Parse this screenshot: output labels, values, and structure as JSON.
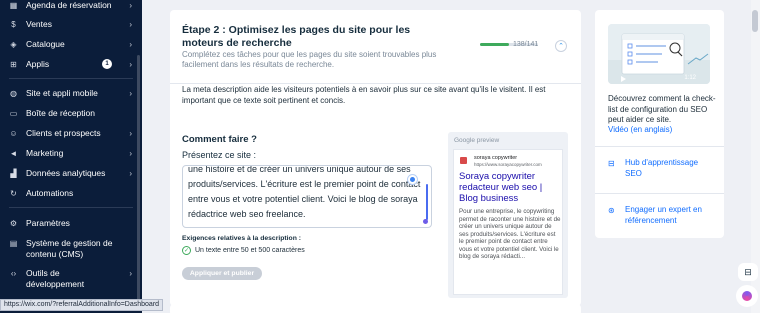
{
  "sidebar": {
    "items": [
      {
        "label": "Agenda de réservation",
        "icon": "calendar-icon",
        "chevron": "›"
      },
      {
        "label": "Ventes",
        "icon": "dollar-icon",
        "chevron": "›"
      },
      {
        "label": "Catalogue",
        "icon": "tag-icon",
        "chevron": "›"
      },
      {
        "label": "Applis",
        "icon": "apps-icon",
        "badge": "1",
        "chevron": "›"
      },
      {
        "label": "Site et appli mobile",
        "icon": "globe-icon",
        "chevron": "›"
      },
      {
        "label": "Boîte de réception",
        "icon": "inbox-icon",
        "chevron": ""
      },
      {
        "label": "Clients et prospects",
        "icon": "users-icon",
        "chevron": "›"
      },
      {
        "label": "Marketing",
        "icon": "megaphone-icon",
        "chevron": "›"
      },
      {
        "label": "Données analytiques",
        "icon": "chart-icon",
        "chevron": "›"
      },
      {
        "label": "Automations",
        "icon": "automation-icon",
        "chevron": ""
      },
      {
        "label": "Paramètres",
        "icon": "gear-icon",
        "chevron": ""
      },
      {
        "label": "Système de gestion de contenu (CMS)",
        "icon": "cms-icon",
        "chevron": ""
      },
      {
        "label": "Outils de développement",
        "icon": "code-icon",
        "chevron": "›"
      }
    ]
  },
  "status_url": "https://wix.com/?referralAdditionalInfo=Dashboard",
  "step": {
    "title": "Étape 2 : Optimisez les pages du site pour les moteurs de recherche",
    "subtitle": "Complétez ces tâches pour que les pages du site soient trouvables plus facilement dans les résultats de recherche.",
    "progress_text": "138/141",
    "progress_fraction": 0.9787,
    "collapse_symbol": "⌃"
  },
  "description": "La meta description aide les visiteurs potentiels à en savoir plus sur ce site avant qu'ils le visitent. Il est important que ce texte soit pertinent et concis.",
  "how": {
    "title": "Comment faire ?",
    "present_label": "Présentez ce site :",
    "textarea_value": "une histoire et de créer un univers unique autour de ses produits/services. L'écriture est le premier point de contact entre vous et votre potentiel client. Voici le blog de soraya rédactrice web seo freelance.",
    "requirements_title": "Exigences relatives à la description :",
    "requirement_1": "Un texte entre 50 et 500 caractères",
    "apply_label": "Appliquer et publier"
  },
  "preview": {
    "label": "Google preview",
    "site_name": "soraya copywriter",
    "site_url": "https://www.sorayacopywriter.com",
    "title": "Soraya copywriter redacteur web seo | Blog business",
    "description": "Pour une entreprise, le copywriting permet de raconter une histoire et de créer un univers unique autour de ses produits/services. L'écriture est le premier point de contact entre vous et votre potentiel client. Voici le blog de soraya rédacti..."
  },
  "right_panel": {
    "thumb_time": "1:12",
    "text": "Découvrez comment la check-list de configuration du SEO peut aider ce site.",
    "video_link": "Vidéo (en anglais)",
    "link_1": "Hub d'apprentissage SEO",
    "link_2": "Engager un expert en référencement"
  },
  "colors": {
    "sidebar_bg": "#0b1d3a",
    "accent": "#116dff",
    "success": "#3eaa5c"
  }
}
